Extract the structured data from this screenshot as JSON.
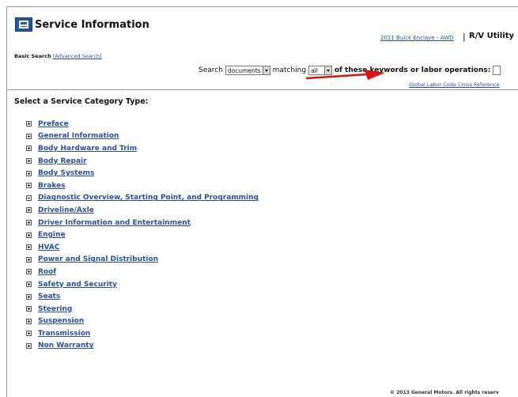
{
  "header": {
    "app_title": "Service Information",
    "vehicle_link": "2011 Buick Enclave - AWD",
    "separator": "|",
    "context_label": "R/V Utility"
  },
  "search": {
    "basic_label": "Basic Search",
    "advanced_link": "[Advanced Search]",
    "prefix": "Search",
    "type_value": "documents",
    "matching_label": "matching",
    "match_value": "all",
    "suffix": "of these keywords or labor operations:",
    "labor_link": "Global Labor Code Cross Reference"
  },
  "categories": {
    "title": "Select a Service Category Type:",
    "items": [
      {
        "label": "Preface",
        "state": "collapsed"
      },
      {
        "label": "General Information",
        "state": "collapsed"
      },
      {
        "label": "Body Hardware and Trim",
        "state": "collapsed"
      },
      {
        "label": "Body Repair",
        "state": "collapsed"
      },
      {
        "label": "Body Systems",
        "state": "collapsed"
      },
      {
        "label": "Brakes",
        "state": "collapsed"
      },
      {
        "label": "Diagnostic Overview, Starting Point, and Programming",
        "state": "expanded"
      },
      {
        "label": "Driveline/Axle",
        "state": "collapsed"
      },
      {
        "label": "Driver Information and Entertainment",
        "state": "collapsed"
      },
      {
        "label": "Engine",
        "state": "collapsed"
      },
      {
        "label": "HVAC",
        "state": "collapsed"
      },
      {
        "label": "Power and Signal Distribution",
        "state": "collapsed"
      },
      {
        "label": "Roof",
        "state": "collapsed"
      },
      {
        "label": "Safety and Security",
        "state": "collapsed"
      },
      {
        "label": "Seats",
        "state": "collapsed"
      },
      {
        "label": "Steering",
        "state": "collapsed"
      },
      {
        "label": "Suspension",
        "state": "collapsed"
      },
      {
        "label": "Transmission",
        "state": "collapsed"
      },
      {
        "label": "Non Warranty",
        "state": "collapsed"
      }
    ]
  },
  "footer": {
    "copyright": "© 2013 General Motors.  All rights reserv"
  },
  "colors": {
    "link": "#2a4ea8",
    "annotation_arrow": "#e01010",
    "logo": "#2553a6"
  },
  "icons": {
    "logo": "gm-logo-icon",
    "expand": "plus-box-icon",
    "collapse": "minus-box-icon",
    "dropdown": "chevron-down-icon",
    "annotation": "red-arrow-icon"
  }
}
